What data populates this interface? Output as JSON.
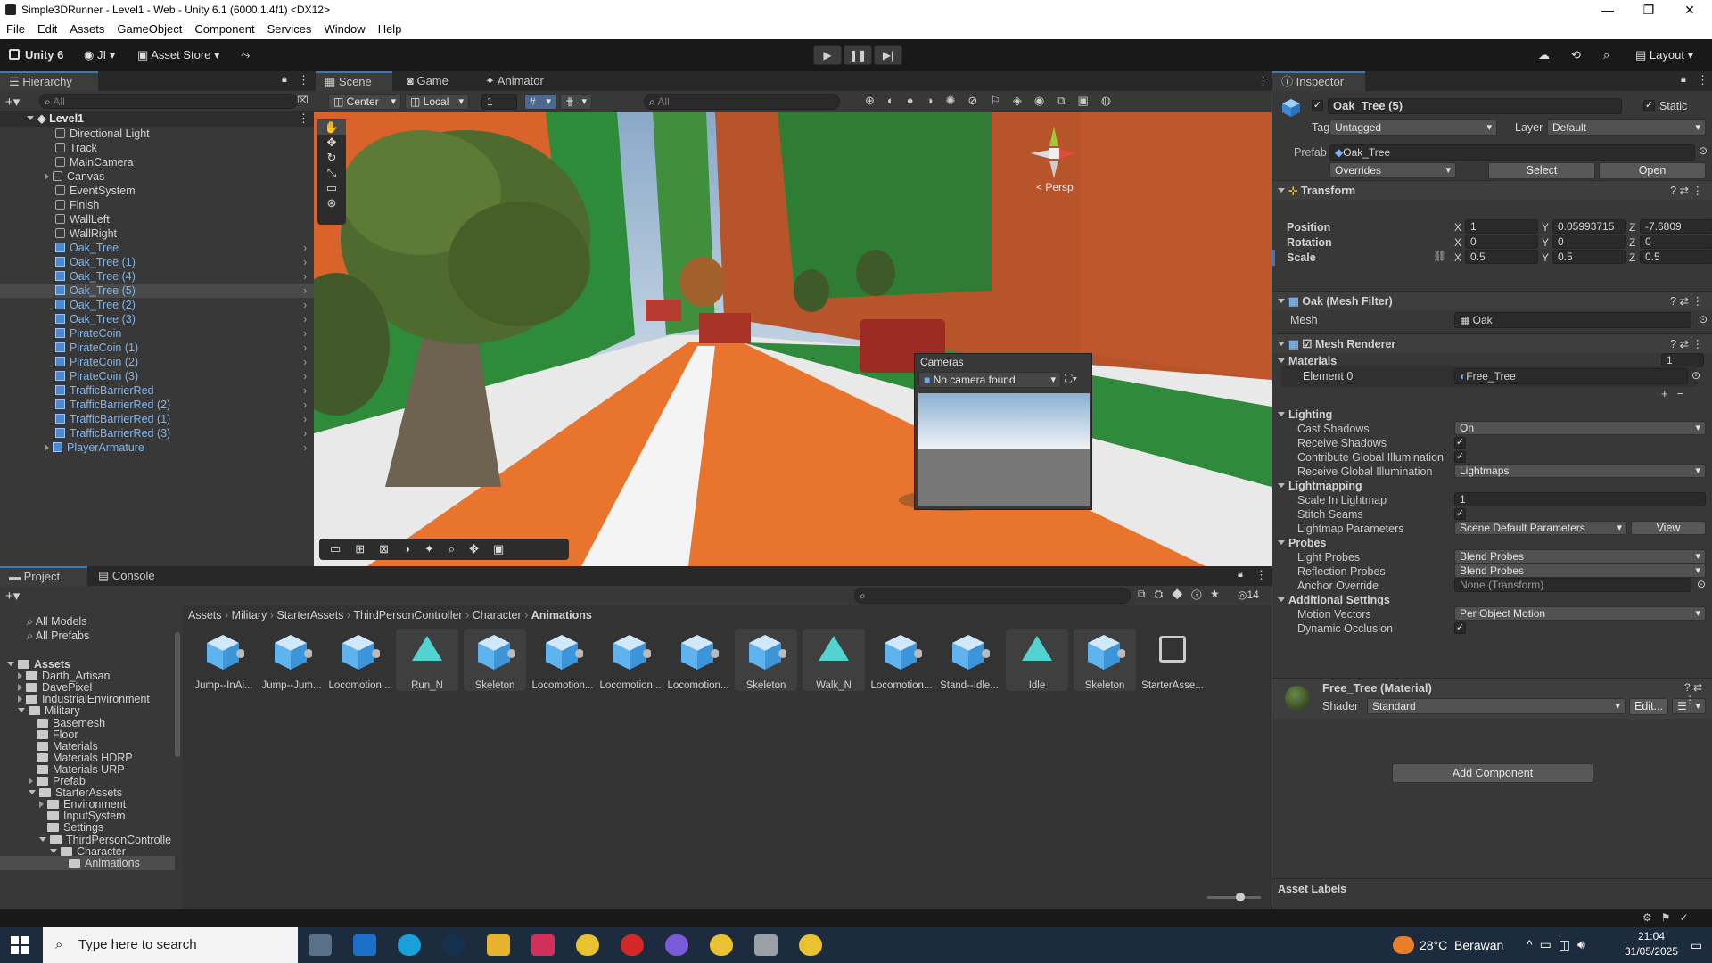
{
  "window": {
    "title": "Simple3DRunner - Level1 - Web - Unity 6.1 (6000.1.4f1) <DX12>",
    "min": "—",
    "max": "❐",
    "close": "✕"
  },
  "menu": [
    "File",
    "Edit",
    "Assets",
    "GameObject",
    "Component",
    "Services",
    "Window",
    "Help"
  ],
  "toolbar": {
    "unity": "Unity 6",
    "account": "JI",
    "asset_store": "Asset Store",
    "layout": "Layout"
  },
  "hierarchy": {
    "tab": "Hierarchy",
    "search": "All",
    "scene": "Level1",
    "items": [
      "Directional Light",
      "Track",
      "MainCamera",
      "Canvas",
      "EventSystem",
      "Finish",
      "WallLeft",
      "WallRight",
      "Oak_Tree",
      "Oak_Tree (1)",
      "Oak_Tree (4)",
      "Oak_Tree (5)",
      "Oak_Tree (2)",
      "Oak_Tree (3)",
      "PirateCoin",
      "PirateCoin (1)",
      "PirateCoin (2)",
      "PirateCoin (3)",
      "TrafficBarrierRed",
      "TrafficBarrierRed (2)",
      "TrafficBarrierRed (1)",
      "TrafficBarrierRed (3)",
      "PlayerArmature"
    ]
  },
  "scene": {
    "tabs": [
      "Scene",
      "Game",
      "Animator"
    ],
    "pivot": "Center",
    "space": "Local",
    "grid_size": "1",
    "search": "All",
    "persp": "< Persp",
    "cameras": {
      "title": "Cameras",
      "dropdown": "No camera found"
    }
  },
  "project": {
    "tabs": [
      "Project",
      "Console"
    ],
    "count": "14",
    "favorites": [
      "All Models",
      "All Prefabs"
    ],
    "tree": [
      "Assets",
      "Darth_Artisan",
      "DavePixel",
      "IndustrialEnvironment",
      "Military",
      "Basemesh",
      "Floor",
      "Materials",
      "Materials HDRP",
      "Materials URP",
      "Prefab",
      "StarterAssets",
      "Environment",
      "InputSystem",
      "Settings",
      "ThirdPersonControlle",
      "Character",
      "Animations"
    ],
    "breadcrumb": [
      "Assets",
      "Military",
      "StarterAssets",
      "ThirdPersonController",
      "Character",
      "Animations"
    ],
    "assets": [
      "Jump--InAi...",
      "Jump--Jum...",
      "Locomotion...",
      "Run_N",
      "Skeleton",
      "Locomotion...",
      "Locomotion...",
      "Locomotion...",
      "Skeleton",
      "Walk_N",
      "Locomotion...",
      "Stand--Idle...",
      "Idle",
      "Skeleton",
      "StarterAsse..."
    ]
  },
  "inspector": {
    "tab": "Inspector",
    "name": "Oak_Tree (5)",
    "static": "Static",
    "tag_label": "Tag",
    "tag": "Untagged",
    "layer_label": "Layer",
    "layer": "Default",
    "prefab_label": "Prefab",
    "prefab": "Oak_Tree",
    "overrides": "Overrides",
    "select": "Select",
    "open": "Open",
    "transform": {
      "title": "Transform",
      "position": [
        "1",
        "0.05993715",
        "-7.6809"
      ],
      "rotation": [
        "0",
        "0",
        "0"
      ],
      "scale": [
        "0.5",
        "0.5",
        "0.5"
      ],
      "labels": [
        "Position",
        "Rotation",
        "Scale"
      ]
    },
    "mesh_filter": {
      "title": "Oak (Mesh Filter)",
      "mesh_label": "Mesh",
      "mesh": "Oak"
    },
    "mesh_renderer": {
      "title": "Mesh Renderer",
      "materials": "Materials",
      "count": "1",
      "element": "Element 0",
      "material": "Free_Tree",
      "lighting": "Lighting",
      "cast_shadows_label": "Cast Shadows",
      "cast_shadows": "On",
      "receive_shadows": "Receive Shadows",
      "contribute_gi": "Contribute Global Illumination",
      "receive_gi_label": "Receive Global Illumination",
      "receive_gi": "Lightmaps",
      "lightmapping": "Lightmapping",
      "scale_lightmap_label": "Scale In Lightmap",
      "scale_lightmap": "1",
      "stitch": "Stitch Seams",
      "lm_params_label": "Lightmap Parameters",
      "lm_params": "Scene Default Parameters",
      "view": "View",
      "probes": "Probes",
      "light_probes_label": "Light Probes",
      "light_probes": "Blend Probes",
      "refl_probes_label": "Reflection Probes",
      "refl_probes": "Blend Probes",
      "anchor_label": "Anchor Override",
      "anchor": "None (Transform)",
      "additional": "Additional Settings",
      "motion_label": "Motion Vectors",
      "motion": "Per Object Motion",
      "dynocc": "Dynamic Occlusion"
    },
    "material": {
      "title": "Free_Tree (Material)",
      "shader_label": "Shader",
      "shader": "Standard",
      "edit": "Edit..."
    },
    "add_component": "Add Component",
    "asset_labels": "Asset Labels"
  },
  "taskbar": {
    "search": "Type here to search",
    "weather": "28°C  Berawan",
    "time": "21:04",
    "date": "31/05/2025"
  }
}
